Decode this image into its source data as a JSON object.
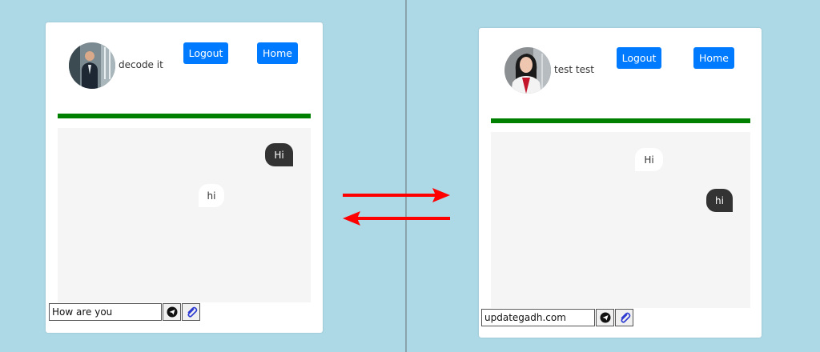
{
  "colors": {
    "background": "#add8e6",
    "button": "#007bff",
    "status_bar": "#008000",
    "dark_bubble": "#333333",
    "arrow": "#ff0000"
  },
  "left_chat": {
    "username": "decode it",
    "logout_label": "Logout",
    "home_label": "Home",
    "messages": [
      {
        "text": "Hi",
        "style": "dark"
      },
      {
        "text": "hi",
        "style": "light"
      }
    ],
    "input_value": "How are you",
    "send_icon": "send-icon",
    "attach_icon": "paperclip-icon"
  },
  "right_chat": {
    "username": "test test",
    "logout_label": "Logout",
    "home_label": "Home",
    "messages": [
      {
        "text": "Hi",
        "style": "light"
      },
      {
        "text": "hi",
        "style": "dark"
      }
    ],
    "input_value": "updategadh.com",
    "send_icon": "send-icon",
    "attach_icon": "paperclip-icon"
  }
}
